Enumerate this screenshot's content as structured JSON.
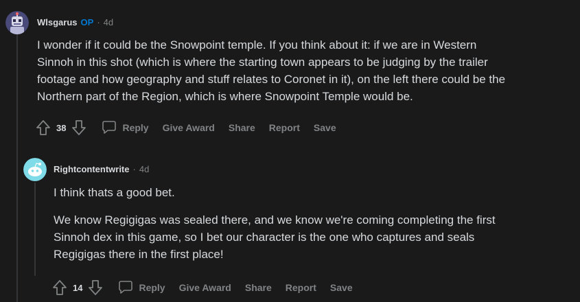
{
  "colors": {
    "background": "#1a1a1b",
    "text": "#d7dadc",
    "muted": "#818384",
    "op_badge": "#0079d3",
    "thread_line": "#343536",
    "avatar2": "#7fdbe8"
  },
  "comments": [
    {
      "username": "Wlsgarus",
      "op_label": "OP",
      "separator": "·",
      "age": "4d",
      "avatar_icon": "robot-avatar-icon",
      "paragraphs": [
        "I wonder if it could be the Snowpoint temple. If you think about it: if we are in Western",
        "Sinnoh in this shot (which is where the starting town appears to be judging by the trailer",
        "footage and how geography and stuff relates to Coronet in it), on the left there could be the",
        "Northern part of the Region, which is where Snowpoint Temple would be."
      ],
      "score": "38",
      "actions": [
        "Reply",
        "Give Award",
        "Share",
        "Report",
        "Save"
      ]
    },
    {
      "username": "Rightcontentwrite",
      "separator": "·",
      "age": "4d",
      "avatar_icon": "snoo-avatar-icon",
      "paragraphs": [
        "I think thats a good bet.",
        "We know Regigigas was sealed there, and we know we're coming completing the first",
        "Sinnoh dex in this game, so I bet our character is the one who captures and seals",
        "Regigigas there in the first place!"
      ],
      "score": "14",
      "actions": [
        "Reply",
        "Give Award",
        "Share",
        "Report",
        "Save"
      ]
    }
  ]
}
